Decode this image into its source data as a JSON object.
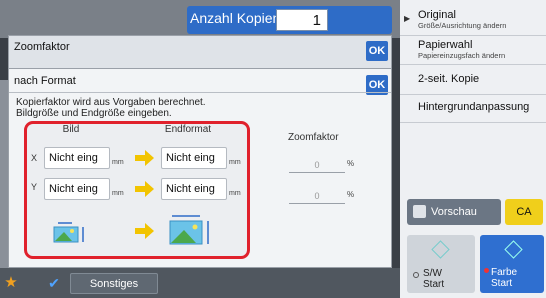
{
  "header": {
    "copies_label": "Anzahl Kopien",
    "copies_value": "1"
  },
  "right_panel": {
    "items": [
      {
        "title": "Original",
        "subtitle": "Größe/Ausrichtung ändern"
      },
      {
        "title": "Papierwahl",
        "subtitle": "Papiereinzugsfach ändern"
      },
      {
        "title": "2-seit. Kopie",
        "subtitle": ""
      },
      {
        "title": "Hintergrundanpassung",
        "subtitle": ""
      }
    ],
    "preview_label": "Vorschau",
    "ca_label": "CA",
    "bw_start": {
      "line1": "S/W",
      "line2": "Start"
    },
    "color_start": {
      "line1": "Farbe",
      "line2": "Start"
    }
  },
  "bottom_bar": {
    "other_label": "Sonstiges"
  },
  "zoom_dialog": {
    "title": "Zoomfaktor",
    "ok_label": "OK"
  },
  "format_dialog": {
    "title": "nach Format",
    "ok_label": "OK",
    "info_line1": "Kopierfaktor wird aus Vorgaben berechnet.",
    "info_line2": "Bildgröße und Endgröße eingeben.",
    "col_image": "Bild",
    "col_final": "Endformat",
    "col_zoom": "Zoomfaktor",
    "x_axis": "X",
    "y_axis": "Y",
    "image_x": "Nicht eing",
    "image_y": "Nicht eing",
    "final_x": "Nicht eing",
    "final_y": "Nicht eing",
    "unit": "mm",
    "zoom_x": "0",
    "zoom_y": "0",
    "percent": "%"
  },
  "colors": {
    "accent": "#2e6cc7",
    "highlight": "#e0212c",
    "arrow": "#f2c400",
    "ca": "#f0cf1b"
  }
}
